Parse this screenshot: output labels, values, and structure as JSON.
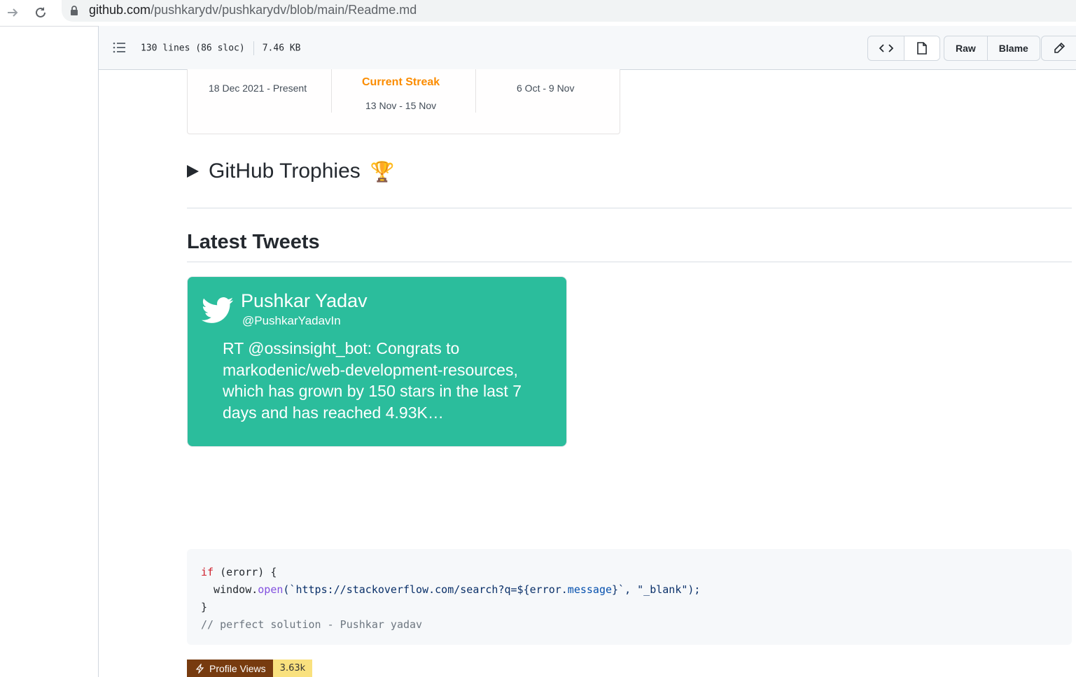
{
  "browser": {
    "url_host": "github.com",
    "url_path": "/pushkarydv/pushkarydv/blob/main/Readme.md"
  },
  "file_header": {
    "lines": "130 lines (86 sloc)",
    "size": "7.46 KB",
    "raw_label": "Raw",
    "blame_label": "Blame"
  },
  "streak": {
    "left_range": "18 Dec 2021 - Present",
    "current_label": "Current Streak",
    "current_range": "13 Nov - 15 Nov",
    "right_range": "6 Oct - 9 Nov",
    "accent_color": "#fb8c00"
  },
  "trophies": {
    "summary": "GitHub Trophies",
    "emoji": "🏆"
  },
  "tweets": {
    "heading": "Latest Tweets",
    "name": "Pushkar Yadav",
    "handle": "@PushkarYadavIn",
    "text": "RT @ossinsight_bot: Congrats to markodenic/web-development-resources, which has grown by 150 stars in the last 7 days and has reached 4.93K…",
    "card_color": "#2bbd9c"
  },
  "code": {
    "line1_kw": "if",
    "line1_rest": " (erorr) {",
    "line2_obj": "  window.",
    "line2_fn": "open",
    "line2_a": "(`https://stackoverflow.com/search?q=${error.",
    "line2_prop": "message",
    "line2_b": "}`, \"_blank\");",
    "line3": "}",
    "line4": "// perfect solution - Pushkar yadav"
  },
  "badge": {
    "label": "Profile Views",
    "value": "3.63k"
  }
}
